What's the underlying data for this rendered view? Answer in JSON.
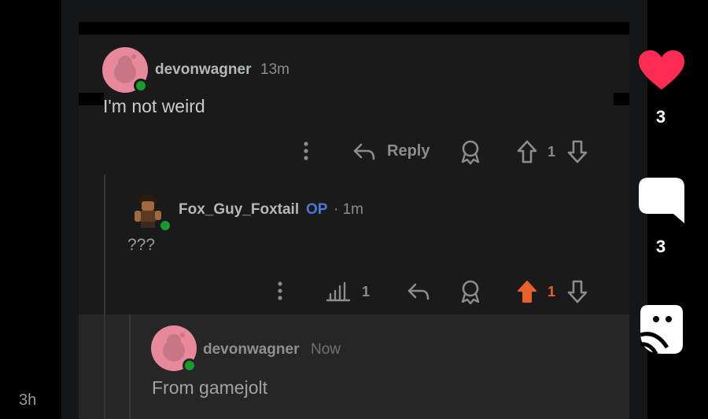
{
  "colors": {
    "background": "#000000",
    "panel": "#1a1a1b",
    "highlight": "#262627",
    "like": "#fe2c55",
    "op_badge": "#4a78d8",
    "upvoted": "#e8602a",
    "online": "#1a9a2a"
  },
  "comments": [
    {
      "username": "devonwagner",
      "time": "13m",
      "text": "I'm not weird",
      "actions": {
        "reply_label": "Reply",
        "vote_count": "1"
      }
    },
    {
      "username": "Fox_Guy_Foxtail",
      "op_badge": "OP",
      "time": "· 1m",
      "text": "???",
      "actions": {
        "stats_count": "1",
        "vote_count": "1"
      }
    },
    {
      "username": "devonwagner",
      "time": "Now",
      "text": "From gamejolt"
    }
  ],
  "sidebar": {
    "like_count": "3",
    "comment_count": "3",
    "share_icon": "share-sticker-icon"
  },
  "post_age": "3h"
}
